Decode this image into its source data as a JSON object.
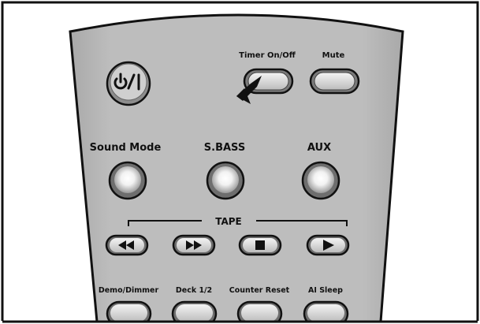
{
  "remote": {
    "labels": {
      "timer": "Timer On/Off",
      "mute": "Mute",
      "sound_mode": "Sound Mode",
      "sbass": "S.BASS",
      "aux": "AUX",
      "tape": "TAPE",
      "demo_dimmer": "Demo/Dimmer",
      "deck": "Deck 1/2",
      "counter_reset": "Counter Reset",
      "ai_sleep": "AI Sleep"
    },
    "power_symbol": "power-icon",
    "tape_buttons": [
      "rewind-icon",
      "fast-forward-icon",
      "stop-icon",
      "play-icon"
    ],
    "pointer": "pen-pointer-icon",
    "colors": {
      "body": "#b9b9b9",
      "body_shade": "#a2a2a2",
      "outline": "#111111",
      "button_light": "#e6e6e6",
      "button_mid": "#c8c8c8",
      "frame": "#111111"
    }
  }
}
